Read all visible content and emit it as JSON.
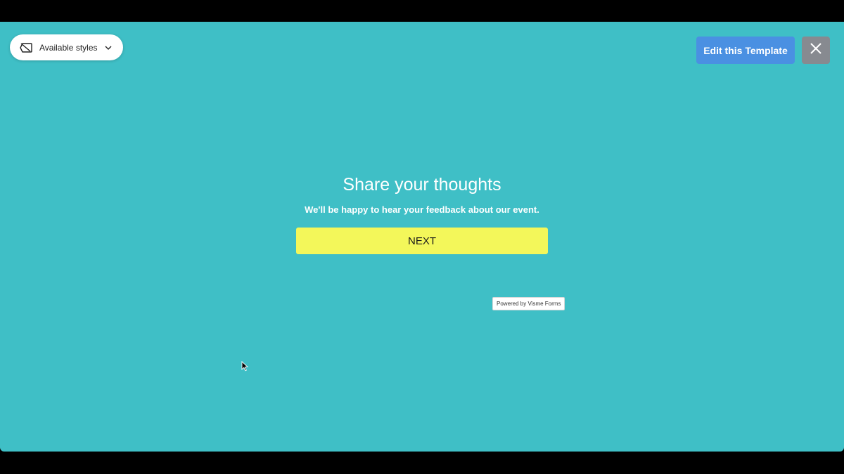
{
  "toolbar": {
    "styles_label": "Available styles",
    "styles_icon": "styles-icon",
    "dropdown_icon": "chevron-down-icon",
    "edit_label": "Edit this Template",
    "close_icon": "close-icon"
  },
  "form": {
    "title": "Share your thoughts",
    "subtitle": "We'll be happy to hear your feedback about our event.",
    "next_label": "NEXT"
  },
  "footer": {
    "powered_by": "Powered by Visme Forms"
  },
  "colors": {
    "background": "#3fbfc6",
    "next_button": "#f3f75a",
    "edit_button": "#4a90e2",
    "close_button": "#878a90"
  }
}
